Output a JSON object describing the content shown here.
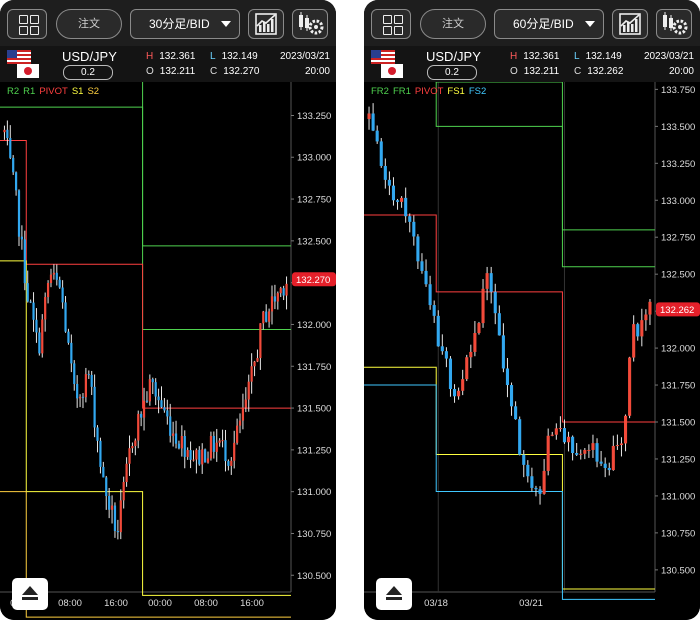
{
  "left": {
    "toolbar": {
      "order_label": "注文",
      "period_label": "30分足/BID"
    },
    "info": {
      "pair": "USD/JPY",
      "spread": "0.2",
      "high_label": "H",
      "high": "132.361",
      "low_label": "L",
      "low": "132.149",
      "open_label": "O",
      "open": "132.211",
      "close_label": "C",
      "close": "132.270",
      "date": "2023/03/21",
      "time": "20:00"
    },
    "legend": [
      {
        "label": "R2",
        "color": "#4fd24f"
      },
      {
        "label": "R1",
        "color": "#4fd24f"
      },
      {
        "label": "PIVOT",
        "color": "#ff4040"
      },
      {
        "label": "S1",
        "color": "#ffff40"
      },
      {
        "label": "S2",
        "color": "#ffd040"
      }
    ],
    "price_ticks": [
      "133.250",
      "133.000",
      "132.750",
      "132.500",
      "132.250",
      "132.000",
      "131.750",
      "131.500",
      "131.250",
      "131.000",
      "130.750",
      "130.500"
    ],
    "current_price": "132.270",
    "time_ticks": [
      "00:00",
      "08:00",
      "16:00",
      "00:00",
      "08:00",
      "16:00"
    ],
    "chart_data": {
      "type": "candlestick",
      "ylim": [
        130.4,
        133.45
      ],
      "ohlc": [],
      "pivot_lines": [
        {
          "name": "R2",
          "color": "#4fd24f",
          "segments": [
            [
              0,
              133.57
            ],
            [
              48,
              132.47
            ],
            [
              98,
              132.47
            ]
          ]
        },
        {
          "name": "R1",
          "color": "#4fd24f",
          "segments": [
            [
              0,
              133.3
            ],
            [
              48,
              131.97
            ],
            [
              98,
              131.97
            ]
          ]
        },
        {
          "name": "PIVOT",
          "color": "#ff4040",
          "segments": [
            [
              0,
              133.1
            ],
            [
              8,
              132.36
            ],
            [
              48,
              131.5
            ],
            [
              98,
              131.5
            ]
          ]
        },
        {
          "name": "S1",
          "color": "#ffff40",
          "segments": [
            [
              0,
              132.38
            ],
            [
              8,
              131.0
            ],
            [
              48,
              130.38
            ],
            [
              98,
              130.38
            ]
          ]
        },
        {
          "name": "S2",
          "color": "#ffd040",
          "segments": [
            [
              0,
              131.0
            ],
            [
              8,
              130.25
            ],
            [
              48,
              130.25
            ],
            [
              98,
              130.25
            ]
          ]
        }
      ]
    }
  },
  "right": {
    "toolbar": {
      "order_label": "注文",
      "period_label": "60分足/BID"
    },
    "info": {
      "pair": "USD/JPY",
      "spread": "0.2",
      "high_label": "H",
      "high": "132.361",
      "low_label": "L",
      "low": "132.149",
      "open_label": "O",
      "open": "132.211",
      "close_label": "C",
      "close": "132.262",
      "date": "2023/03/21",
      "time": "20:00"
    },
    "legend": [
      {
        "label": "FR2",
        "color": "#4fd24f"
      },
      {
        "label": "FR1",
        "color": "#4fd24f"
      },
      {
        "label": "PIVOT",
        "color": "#ff4040"
      },
      {
        "label": "FS1",
        "color": "#ffff40"
      },
      {
        "label": "FS2",
        "color": "#40c8ff"
      }
    ],
    "price_ticks": [
      "133.750",
      "133.500",
      "133.250",
      "133.000",
      "132.750",
      "132.500",
      "132.250",
      "132.000",
      "131.750",
      "131.500",
      "131.250",
      "131.000",
      "130.750",
      "130.500"
    ],
    "current_price": "132.262",
    "time_ticks": [
      "03/18",
      "03/21"
    ],
    "chart_data": {
      "type": "candlestick",
      "ylim": [
        130.35,
        133.8
      ],
      "ohlc": [],
      "pivot_lines": [
        {
          "name": "FR2",
          "color": "#4fd24f",
          "segments": [
            [
              17,
              133.9
            ],
            [
              17,
              133.5
            ],
            [
              48,
              132.8
            ],
            [
              70,
              132.8
            ]
          ]
        },
        {
          "name": "FR1",
          "color": "#4fd24f",
          "segments": [
            [
              17,
              133.9
            ],
            [
              17,
              133.8
            ],
            [
              48,
              132.55
            ],
            [
              70,
              132.55
            ]
          ]
        },
        {
          "name": "PIVOT",
          "color": "#ff4040",
          "segments": [
            [
              0,
              132.9
            ],
            [
              17,
              132.38
            ],
            [
              48,
              131.5
            ],
            [
              70,
              131.5
            ]
          ]
        },
        {
          "name": "FS1",
          "color": "#ffff40",
          "segments": [
            [
              0,
              131.87
            ],
            [
              17,
              131.28
            ],
            [
              48,
              130.37
            ],
            [
              70,
              130.37
            ]
          ]
        },
        {
          "name": "FS2",
          "color": "#40c8ff",
          "segments": [
            [
              0,
              131.75
            ],
            [
              17,
              131.03
            ],
            [
              48,
              130.3
            ],
            [
              70,
              130.3
            ]
          ]
        }
      ]
    }
  }
}
